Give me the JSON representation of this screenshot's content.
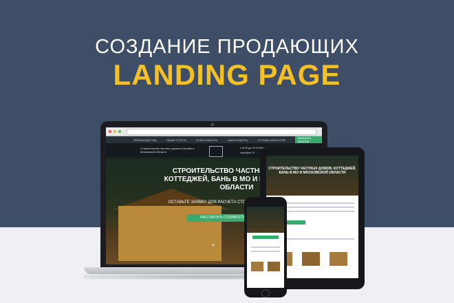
{
  "headline": {
    "line1": "СОЗДАНИЕ ПРОДАЮЩИХ",
    "line2": "LANDING PAGE"
  },
  "laptop_site": {
    "nav": [
      "ПРЕИМУЩЕСТВА",
      "НАШИ УСЛУГИ",
      "ЭТАПЫ РАБОТЫ",
      "НАШИ РАБОТЫ",
      "ОТЗЫВЫ КЛИЕНТОВ"
    ],
    "nav_cta": "ЗАКАЗАТЬ ЗВОНОК",
    "tagline": "Строительство частных домов в Москве и Московской области",
    "hours": "с 8.00 до 22.00 без выходных",
    "phone_label": "телефон: 8",
    "hero_title": "СТРОИТЕЛЬСТВО ЧАСТНЫХ ДОМОВ, КОТТЕДЖЕЙ, БАНЬ В МО И МОСКОВСКОЙ ОБЛАСТИ",
    "hero_sub": "ОСТАВЬТЕ ЗАЯВКУ ДЛЯ РАСЧЕТА СТОИМОСТИ ВАШЕГО БУДУЩЕГО ДОМА",
    "hero_button": "РАССЧИТАТЬ СТОИМОСТЬ ДОМА"
  },
  "colors": {
    "background": "#3f4e67",
    "accent": "#f5c025",
    "cta": "#3aaa6e"
  }
}
